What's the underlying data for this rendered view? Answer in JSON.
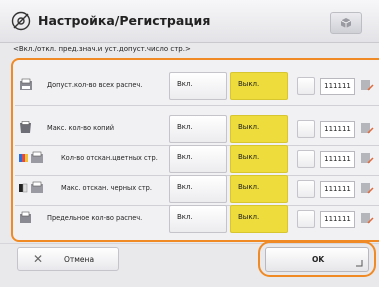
{
  "header": {
    "title": "Настройка/Регистрация",
    "icon": "gear-wrench-icon",
    "right_button_icon": "cube-icon"
  },
  "subtitle": "<Вкл./откл. пред.знач.и уст.допуст.число стр.>",
  "rows": [
    {
      "icon": "print-all-jobs-icon",
      "label": "Допуст.кол-во всех распеч.",
      "on_label": "Вкл.",
      "off_label": "Выкл.",
      "selected": "off",
      "count": "111111"
    },
    {
      "icon": "copies-icon",
      "label": "Макс. кол-во копий",
      "on_label": "Вкл.",
      "off_label": "Выкл.",
      "selected": "off",
      "count": "111111"
    },
    {
      "icon": "color-scan-icon",
      "label": "Кол-во отскан.цветных стр.",
      "on_label": "Вкл.",
      "off_label": "Выкл.",
      "selected": "off",
      "count": "111111"
    },
    {
      "icon": "bw-scan-icon",
      "label": "Макс. отскан. черных стр.",
      "on_label": "Вкл.",
      "off_label": "Выкл.",
      "selected": "off",
      "count": "111111"
    },
    {
      "icon": "print-limit-icon",
      "label": "Предельное кол-во распеч.",
      "on_label": "Вкл.",
      "off_label": "Выкл.",
      "selected": "off",
      "count": "111111"
    }
  ],
  "footer": {
    "cancel_label": "Отмена",
    "ok_label": "OK"
  },
  "colors": {
    "accent": "#f08a24",
    "selected": "#eddc3b"
  }
}
